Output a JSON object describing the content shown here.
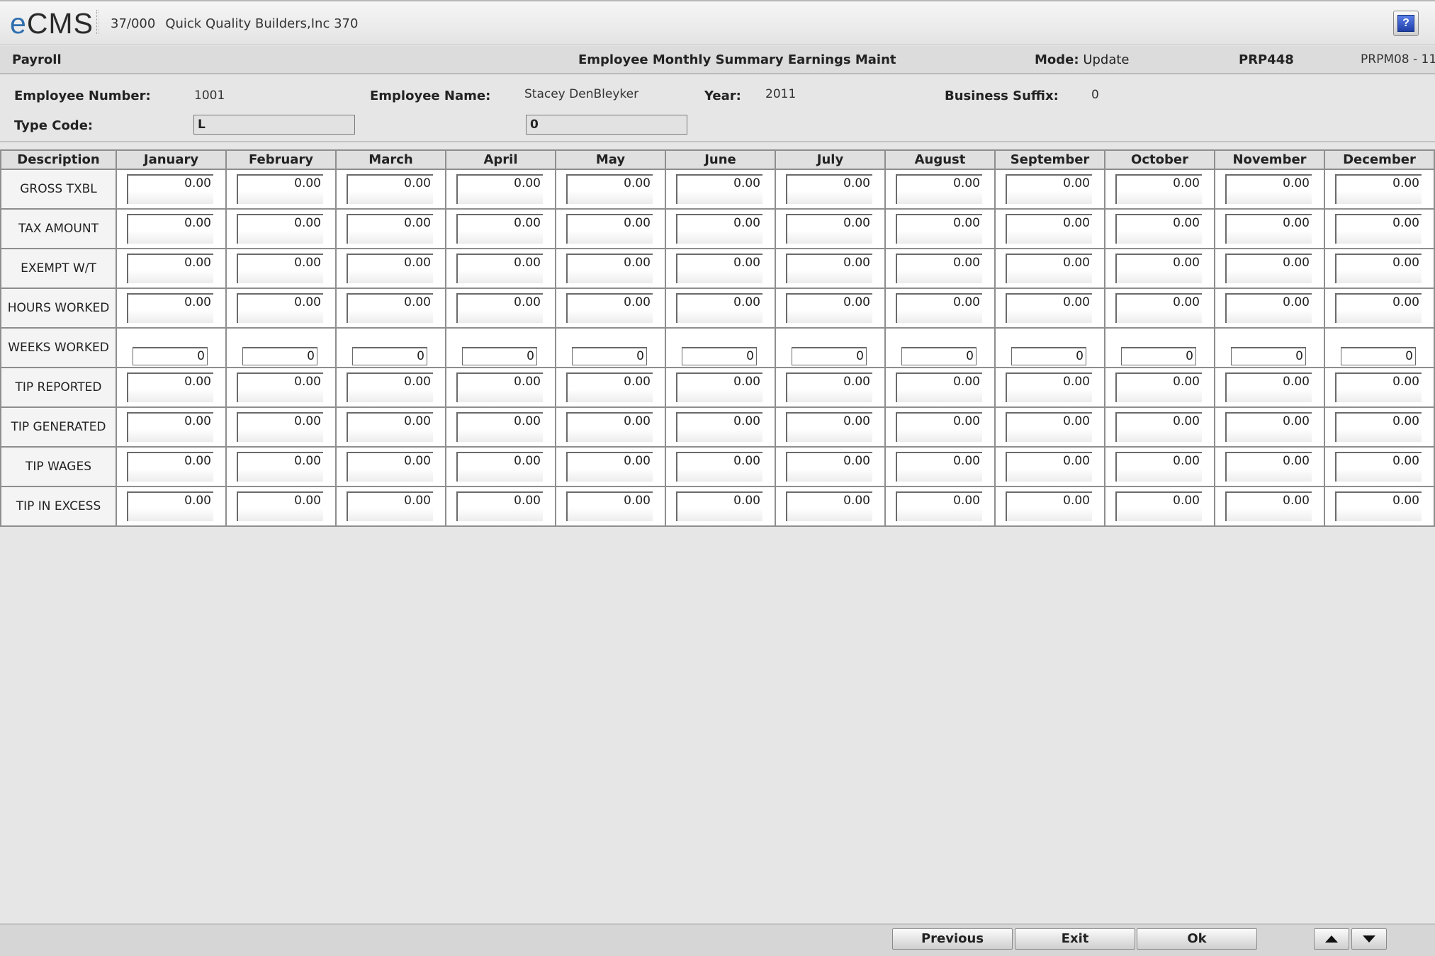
{
  "app": {
    "logo_e": "e",
    "logo_rest": "CMS",
    "company_code": "37/000",
    "company_name": "Quick Quality Builders,Inc 370",
    "help_label": "?"
  },
  "titlebar": {
    "module": "Payroll",
    "title": "Employee Monthly Summary Earnings Maint",
    "mode_label": "Mode:",
    "mode_value": "Update",
    "program": "PRP448",
    "screen_id": "PRPM08 - 11"
  },
  "header": {
    "employee_number_label": "Employee Number:",
    "employee_number": "1001",
    "employee_name_label": "Employee Name:",
    "employee_name": "Stacey DenBleyker",
    "year_label": "Year:",
    "year": "2011",
    "business_suffix_label": "Business Suffix:",
    "business_suffix": "0",
    "type_code_label": "Type Code:",
    "type_code": "L",
    "type_code_2": "0"
  },
  "grid": {
    "desc_header": "Description",
    "months": [
      "January",
      "February",
      "March",
      "April",
      "May",
      "June",
      "July",
      "August",
      "September",
      "October",
      "November",
      "December"
    ],
    "rows": [
      {
        "label": "GROSS TXBL",
        "values": [
          "0.00",
          "0.00",
          "0.00",
          "0.00",
          "0.00",
          "0.00",
          "0.00",
          "0.00",
          "0.00",
          "0.00",
          "0.00",
          "0.00"
        ]
      },
      {
        "label": "TAX AMOUNT",
        "values": [
          "0.00",
          "0.00",
          "0.00",
          "0.00",
          "0.00",
          "0.00",
          "0.00",
          "0.00",
          "0.00",
          "0.00",
          "0.00",
          "0.00"
        ]
      },
      {
        "label": "EXEMPT W/T",
        "values": [
          "0.00",
          "0.00",
          "0.00",
          "0.00",
          "0.00",
          "0.00",
          "0.00",
          "0.00",
          "0.00",
          "0.00",
          "0.00",
          "0.00"
        ]
      },
      {
        "label": "HOURS WORKED",
        "values": [
          "0.00",
          "0.00",
          "0.00",
          "0.00",
          "0.00",
          "0.00",
          "0.00",
          "0.00",
          "0.00",
          "0.00",
          "0.00",
          "0.00"
        ]
      },
      {
        "label": "WEEKS WORKED",
        "values": [
          "0",
          "0",
          "0",
          "0",
          "0",
          "0",
          "0",
          "0",
          "0",
          "0",
          "0",
          "0"
        ]
      },
      {
        "label": "TIP REPORTED",
        "values": [
          "0.00",
          "0.00",
          "0.00",
          "0.00",
          "0.00",
          "0.00",
          "0.00",
          "0.00",
          "0.00",
          "0.00",
          "0.00",
          "0.00"
        ]
      },
      {
        "label": "TIP GENERATED",
        "values": [
          "0.00",
          "0.00",
          "0.00",
          "0.00",
          "0.00",
          "0.00",
          "0.00",
          "0.00",
          "0.00",
          "0.00",
          "0.00",
          "0.00"
        ]
      },
      {
        "label": "TIP WAGES",
        "values": [
          "0.00",
          "0.00",
          "0.00",
          "0.00",
          "0.00",
          "0.00",
          "0.00",
          "0.00",
          "0.00",
          "0.00",
          "0.00",
          "0.00"
        ]
      },
      {
        "label": "TIP IN EXCESS",
        "values": [
          "0.00",
          "0.00",
          "0.00",
          "0.00",
          "0.00",
          "0.00",
          "0.00",
          "0.00",
          "0.00",
          "0.00",
          "0.00",
          "0.00"
        ]
      }
    ]
  },
  "footer": {
    "previous_label": "Previous",
    "exit_label": "Exit",
    "ok_label": "Ok",
    "scroll_up_icon": "triangle-up-icon",
    "scroll_down_icon": "triangle-down-icon"
  }
}
